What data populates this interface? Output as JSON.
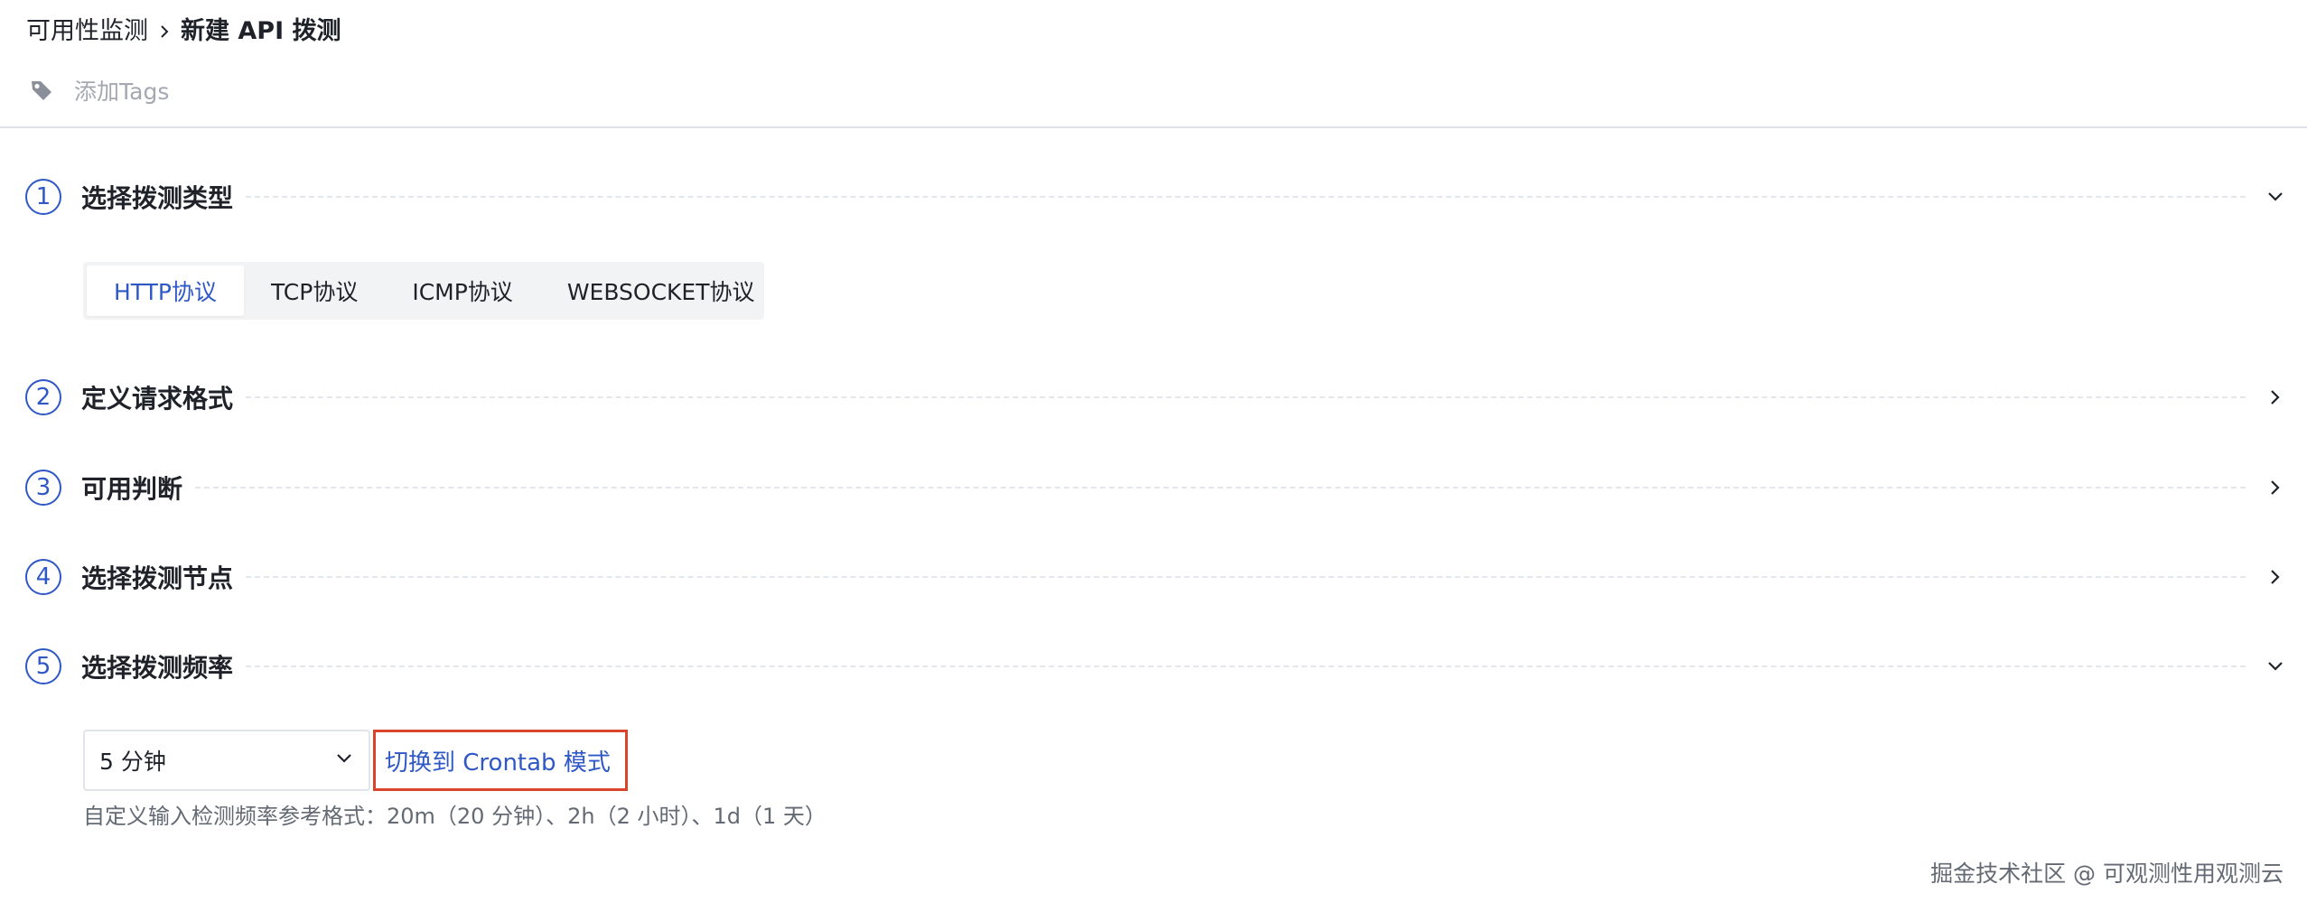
{
  "breadcrumb": {
    "parent": "可用性监测",
    "current": "新建 API 拨测"
  },
  "tags": {
    "placeholder": "添加Tags"
  },
  "steps": [
    {
      "number": "1",
      "title": "选择拨测类型",
      "expanded": true
    },
    {
      "number": "2",
      "title": "定义请求格式",
      "expanded": false
    },
    {
      "number": "3",
      "title": "可用判断",
      "expanded": false
    },
    {
      "number": "4",
      "title": "选择拨测节点",
      "expanded": false
    },
    {
      "number": "5",
      "title": "选择拨测频率",
      "expanded": true
    }
  ],
  "protocol_tabs": [
    {
      "label": "HTTP协议",
      "active": true
    },
    {
      "label": "TCP协议",
      "active": false
    },
    {
      "label": "ICMP协议",
      "active": false
    },
    {
      "label": "WEBSOCKET协议",
      "active": false
    }
  ],
  "frequency": {
    "selected": "5 分钟",
    "crontab_link": "切换到 Crontab 模式",
    "help_text": "自定义输入检测频率参考格式：20m（20 分钟）、2h（2 小时）、1d（1 天）"
  },
  "watermark": "掘金技术社区 @ 可观测性用观测云",
  "colors": {
    "accent": "#2f58c6",
    "highlight_border": "#d9442a",
    "text": "#1f2329",
    "muted": "#646a73"
  },
  "icons": {
    "tag": "tag-icon",
    "breadcrumb_separator": "chevron-right-icon",
    "expanded": "chevron-down-icon",
    "collapsed": "chevron-right-icon",
    "select": "chevron-down-icon"
  }
}
